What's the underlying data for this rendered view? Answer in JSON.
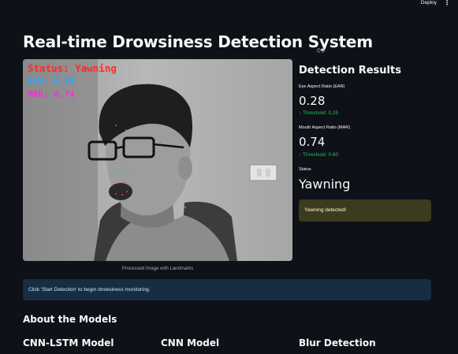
{
  "header": {
    "deploy_label": "Deploy",
    "menu_icon": "kebab-icon"
  },
  "page": {
    "title": "Real-time Drowsiness Detection System",
    "title_link_icon": "link-icon"
  },
  "camera": {
    "overlay_status": "Status: Yawning",
    "overlay_ear": "EAR: 0.28",
    "overlay_mar": "MAR: 0.74",
    "caption": "Processed Image with Landmarks",
    "overlay_colors": {
      "status": "#ff2a2a",
      "ear": "#25a6ff",
      "mar": "#ff2ad8"
    }
  },
  "results": {
    "title": "Detection Results",
    "ear": {
      "label": "Eye Aspect Ratio (EAR)",
      "value": "0.28",
      "delta": "Threshold: 0.25"
    },
    "mar": {
      "label": "Mouth Aspect Ratio (MAR)",
      "value": "0.74",
      "delta": "Threshold: 0.60"
    },
    "status": {
      "label": "Status",
      "value": "Yawning"
    },
    "alert": "Yawning detected!"
  },
  "info_message": "Click 'Start Detection' to begin drowsiness monitoring.",
  "about": {
    "title": "About the Models",
    "columns": [
      "CNN-LSTM Model",
      "CNN Model",
      "Blur Detection"
    ]
  },
  "colors": {
    "background": "#0e1117",
    "delta_green": "#21c354",
    "warning_bg": "#3d3b1f",
    "info_bg": "#172d43"
  }
}
